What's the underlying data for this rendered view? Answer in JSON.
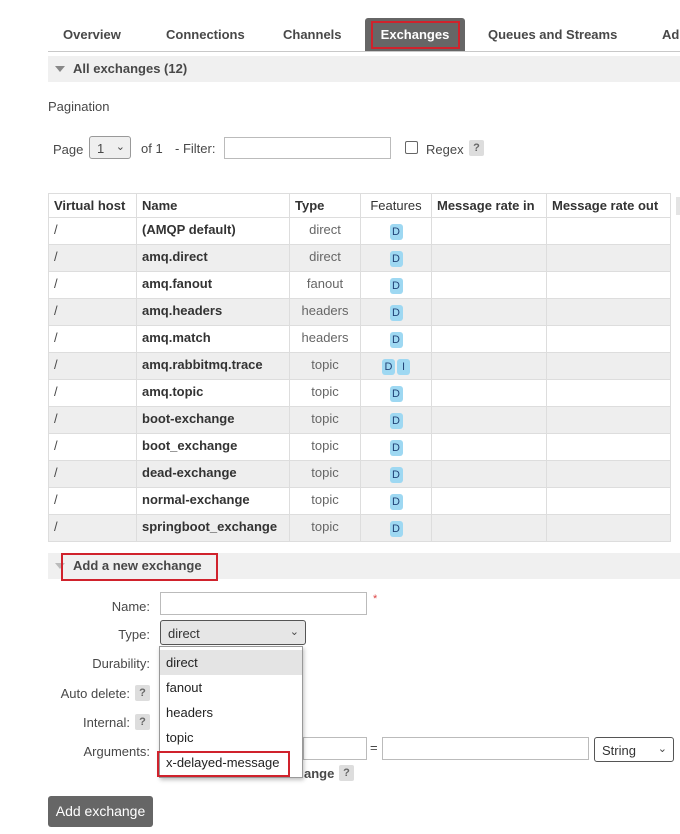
{
  "nav": {
    "tabs": [
      {
        "label": "Overview"
      },
      {
        "label": "Connections"
      },
      {
        "label": "Channels"
      },
      {
        "label": "Exchanges",
        "active": true
      },
      {
        "label": "Queues and Streams"
      },
      {
        "label": "Ad"
      }
    ]
  },
  "all_exchanges": {
    "header": "All exchanges (12)",
    "pagination_label": "Pagination",
    "page_label": "Page",
    "page_value": "1",
    "of_label": "of 1",
    "filter_label": "- Filter:",
    "filter_value": "",
    "regex_label": "Regex",
    "help_mark": "?"
  },
  "table": {
    "headers": [
      "Virtual host",
      "Name",
      "Type",
      "Features",
      "Message rate in",
      "Message rate out"
    ],
    "rows": [
      {
        "vhost": "/",
        "name": "(AMQP default)",
        "type": "direct",
        "features": [
          "D"
        ]
      },
      {
        "vhost": "/",
        "name": "amq.direct",
        "type": "direct",
        "features": [
          "D"
        ]
      },
      {
        "vhost": "/",
        "name": "amq.fanout",
        "type": "fanout",
        "features": [
          "D"
        ]
      },
      {
        "vhost": "/",
        "name": "amq.headers",
        "type": "headers",
        "features": [
          "D"
        ]
      },
      {
        "vhost": "/",
        "name": "amq.match",
        "type": "headers",
        "features": [
          "D"
        ]
      },
      {
        "vhost": "/",
        "name": "amq.rabbitmq.trace",
        "type": "topic",
        "features": [
          "D",
          "I"
        ]
      },
      {
        "vhost": "/",
        "name": "amq.topic",
        "type": "topic",
        "features": [
          "D"
        ]
      },
      {
        "vhost": "/",
        "name": "boot-exchange",
        "type": "topic",
        "features": [
          "D"
        ]
      },
      {
        "vhost": "/",
        "name": "boot_exchange",
        "type": "topic",
        "features": [
          "D"
        ]
      },
      {
        "vhost": "/",
        "name": "dead-exchange",
        "type": "topic",
        "features": [
          "D"
        ]
      },
      {
        "vhost": "/",
        "name": "normal-exchange",
        "type": "topic",
        "features": [
          "D"
        ]
      },
      {
        "vhost": "/",
        "name": "springboot_exchange",
        "type": "topic",
        "features": [
          "D"
        ]
      }
    ]
  },
  "add_exchange": {
    "header": "Add a new exchange",
    "name_label": "Name:",
    "name_value": "",
    "required_mark": "*",
    "type_label": "Type:",
    "type_value": "direct",
    "type_options": [
      "direct",
      "fanout",
      "headers",
      "topic",
      "x-delayed-message"
    ],
    "durability_label": "Durability:",
    "auto_delete_label": "Auto delete:",
    "internal_label": "Internal:",
    "arguments_label": "Arguments:",
    "equals": "=",
    "arg_type_value": "String",
    "add_arg_partial": "ange",
    "submit_label": "Add exchange"
  },
  "colors": {
    "active_tab_bg": "#666666",
    "highlight_red": "#d0222c",
    "badge_bg": "#9ed8f2",
    "row_alt_bg": "#eeeeee"
  }
}
